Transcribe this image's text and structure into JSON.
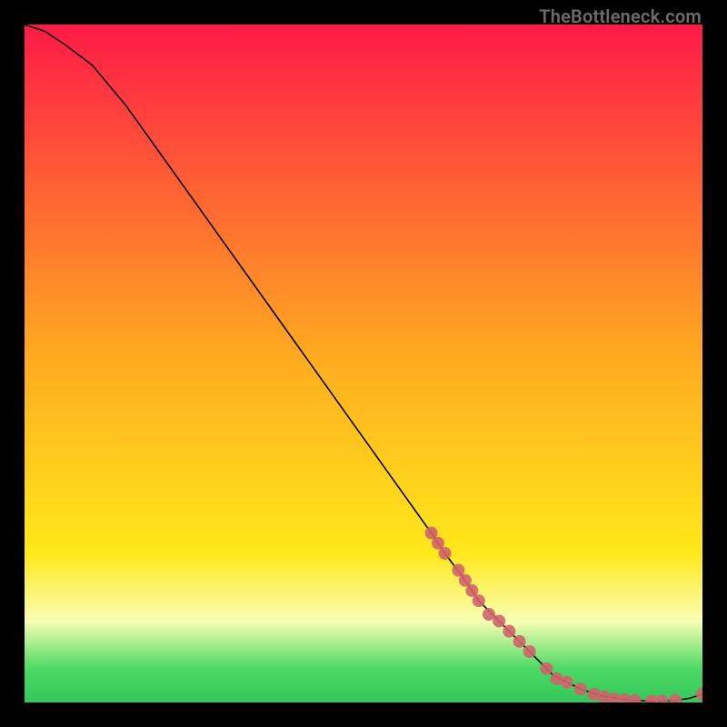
{
  "watermark": "TheBottleneck.com",
  "chart_data": {
    "type": "line",
    "title": "",
    "xlabel": "",
    "ylabel": "",
    "xlim": [
      0,
      100
    ],
    "ylim": [
      0,
      100
    ],
    "background_gradient": {
      "direction": "vertical",
      "stops": [
        {
          "pos": 0.0,
          "color": "#ff1a47"
        },
        {
          "pos": 0.5,
          "color": "#ffad1f"
        },
        {
          "pos": 0.78,
          "color": "#ffe81a"
        },
        {
          "pos": 0.88,
          "color": "#f9ffb3"
        },
        {
          "pos": 0.95,
          "color": "#4cd964"
        },
        {
          "pos": 1.0,
          "color": "#34c759"
        }
      ]
    },
    "series": [
      {
        "name": "curve",
        "x": [
          0,
          3,
          6,
          10,
          15,
          20,
          25,
          30,
          35,
          40,
          45,
          50,
          55,
          60,
          62,
          65,
          67,
          70,
          72,
          75,
          78,
          80,
          82,
          85,
          88,
          90,
          92,
          94,
          96,
          98,
          100
        ],
        "values": [
          100,
          99,
          97,
          94,
          88,
          81,
          74,
          67,
          60,
          53,
          46,
          39,
          32,
          25,
          22,
          18,
          15,
          12,
          10,
          7,
          4,
          3,
          2,
          1,
          0.5,
          0.3,
          0.2,
          0.2,
          0.3,
          0.6,
          1.2
        ]
      }
    ],
    "scatter": [
      {
        "x": 60,
        "y": 25
      },
      {
        "x": 61,
        "y": 23.5
      },
      {
        "x": 62,
        "y": 22
      },
      {
        "x": 64,
        "y": 19.5
      },
      {
        "x": 65,
        "y": 18
      },
      {
        "x": 66,
        "y": 16.5
      },
      {
        "x": 67,
        "y": 15
      },
      {
        "x": 68.5,
        "y": 13
      },
      {
        "x": 70,
        "y": 12
      },
      {
        "x": 71.5,
        "y": 10.5
      },
      {
        "x": 73,
        "y": 9
      },
      {
        "x": 74.5,
        "y": 7.5
      },
      {
        "x": 77,
        "y": 5
      },
      {
        "x": 78.5,
        "y": 3.5
      },
      {
        "x": 80,
        "y": 3
      },
      {
        "x": 82,
        "y": 2
      },
      {
        "x": 84,
        "y": 1.2
      },
      {
        "x": 85.5,
        "y": 0.8
      },
      {
        "x": 87,
        "y": 0.5
      },
      {
        "x": 88.5,
        "y": 0.4
      },
      {
        "x": 90,
        "y": 0.3
      },
      {
        "x": 92.5,
        "y": 0.2
      },
      {
        "x": 94,
        "y": 0.2
      },
      {
        "x": 96,
        "y": 0.3
      },
      {
        "x": 100,
        "y": 1.2
      }
    ],
    "dot_color": "#d2636b",
    "line_color": "#000000"
  }
}
